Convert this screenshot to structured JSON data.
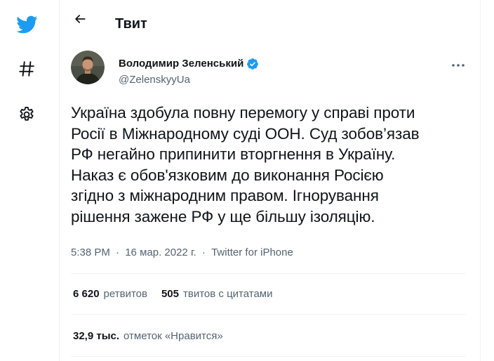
{
  "colors": {
    "brand": "#1d9bf0",
    "text": "#0f1419",
    "muted": "#536471",
    "border": "#eff3f4"
  },
  "nav": {
    "items": [
      {
        "icon": "twitter-bird-icon"
      },
      {
        "icon": "hashtag-icon"
      },
      {
        "icon": "gear-icon"
      }
    ]
  },
  "header": {
    "title": "Твит",
    "back_icon": "back-arrow-icon"
  },
  "tweet": {
    "author_name": "Володимир Зеленський",
    "author_handle": "@ZelenskyyUa",
    "verified": true,
    "text": "Україна здобула повну перемогу у справі проти\nРосії в Міжнародному суді ООН. Суд зобов’язав\nРФ негайно припинити вторгнення в Україну.\nНаказ є обов'язковим до виконання Росією\nзгідно з міжнародним правом. Ігнорування\nрішення зажене РФ у ще більшу ізоляцію.",
    "time": "5:38 PM",
    "date": "16 мар. 2022 г.",
    "source": "Twitter for iPhone",
    "separator": "·"
  },
  "stats": {
    "retweets_count": "6 620",
    "retweets_label": "ретвитов",
    "quotes_count": "505",
    "quotes_label": "твитов с цитатами",
    "likes_count": "32,9 тыс.",
    "likes_label": "отметок «Нравится»"
  }
}
